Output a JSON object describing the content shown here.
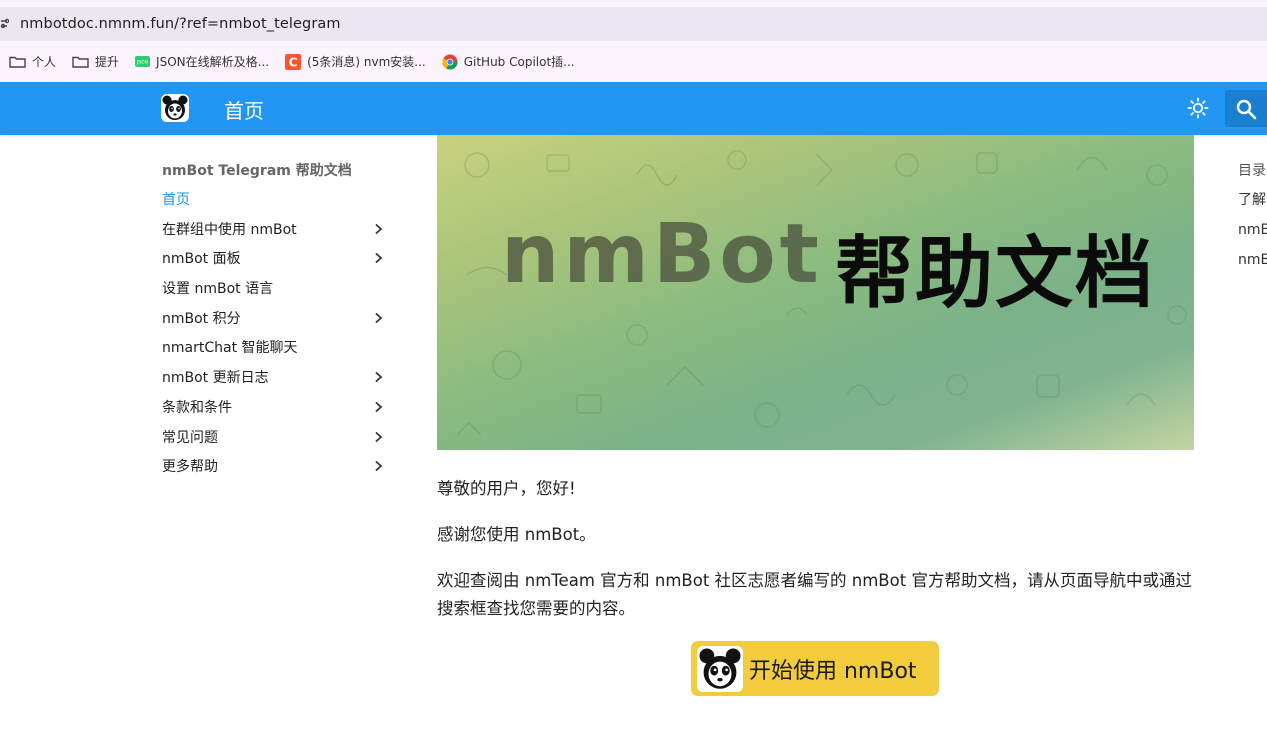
{
  "browser": {
    "url": "nmbotdoc.nmnm.fun/?ref=nmbot_telegram",
    "bookmarks": [
      {
        "label": "个人",
        "icon": "folder-icon"
      },
      {
        "label": "提升",
        "icon": "folder-icon"
      },
      {
        "label": "JSON在线解析及格...",
        "icon": "json-site-icon"
      },
      {
        "label": "(5条消息) nvm安装...",
        "icon": "csdn-icon"
      },
      {
        "label": "GitHub Copilot插...",
        "icon": "chrome-icon"
      }
    ]
  },
  "header": {
    "title": "首页",
    "accent": "#2196f3"
  },
  "sidebar": {
    "title": "nmBot Telegram 帮助文档",
    "items": [
      {
        "label": "首页",
        "active": true,
        "expandable": false
      },
      {
        "label": "在群组中使用 nmBot",
        "expandable": true
      },
      {
        "label": "nmBot 面板",
        "expandable": true
      },
      {
        "label": "设置 nmBot 语言",
        "expandable": false
      },
      {
        "label": "nmBot 积分",
        "expandable": true
      },
      {
        "label": "nmartChat 智能聊天",
        "expandable": false
      },
      {
        "label": "nmBot 更新日志",
        "expandable": true
      },
      {
        "label": "条款和条件",
        "expandable": true
      },
      {
        "label": "常见问题",
        "expandable": true
      },
      {
        "label": "更多帮助",
        "expandable": true
      }
    ]
  },
  "toc": {
    "title": "目录",
    "items": [
      "了解",
      "nmB",
      "nmB"
    ]
  },
  "main": {
    "banner": {
      "word": "nmBot",
      "title": "帮助文档"
    },
    "greeting": "尊敬的用户，您好!",
    "thanks": "感谢您使用 nmBot。",
    "intro": "欢迎查阅由 nmTeam 官方和 nmBot 社区志愿者编写的 nmBot 官方帮助文档，请从页面导航中或通过搜索框查找您需要的内容。",
    "cta_label": "开始使用 nmBot",
    "cta_color": "#f2cc3c"
  }
}
